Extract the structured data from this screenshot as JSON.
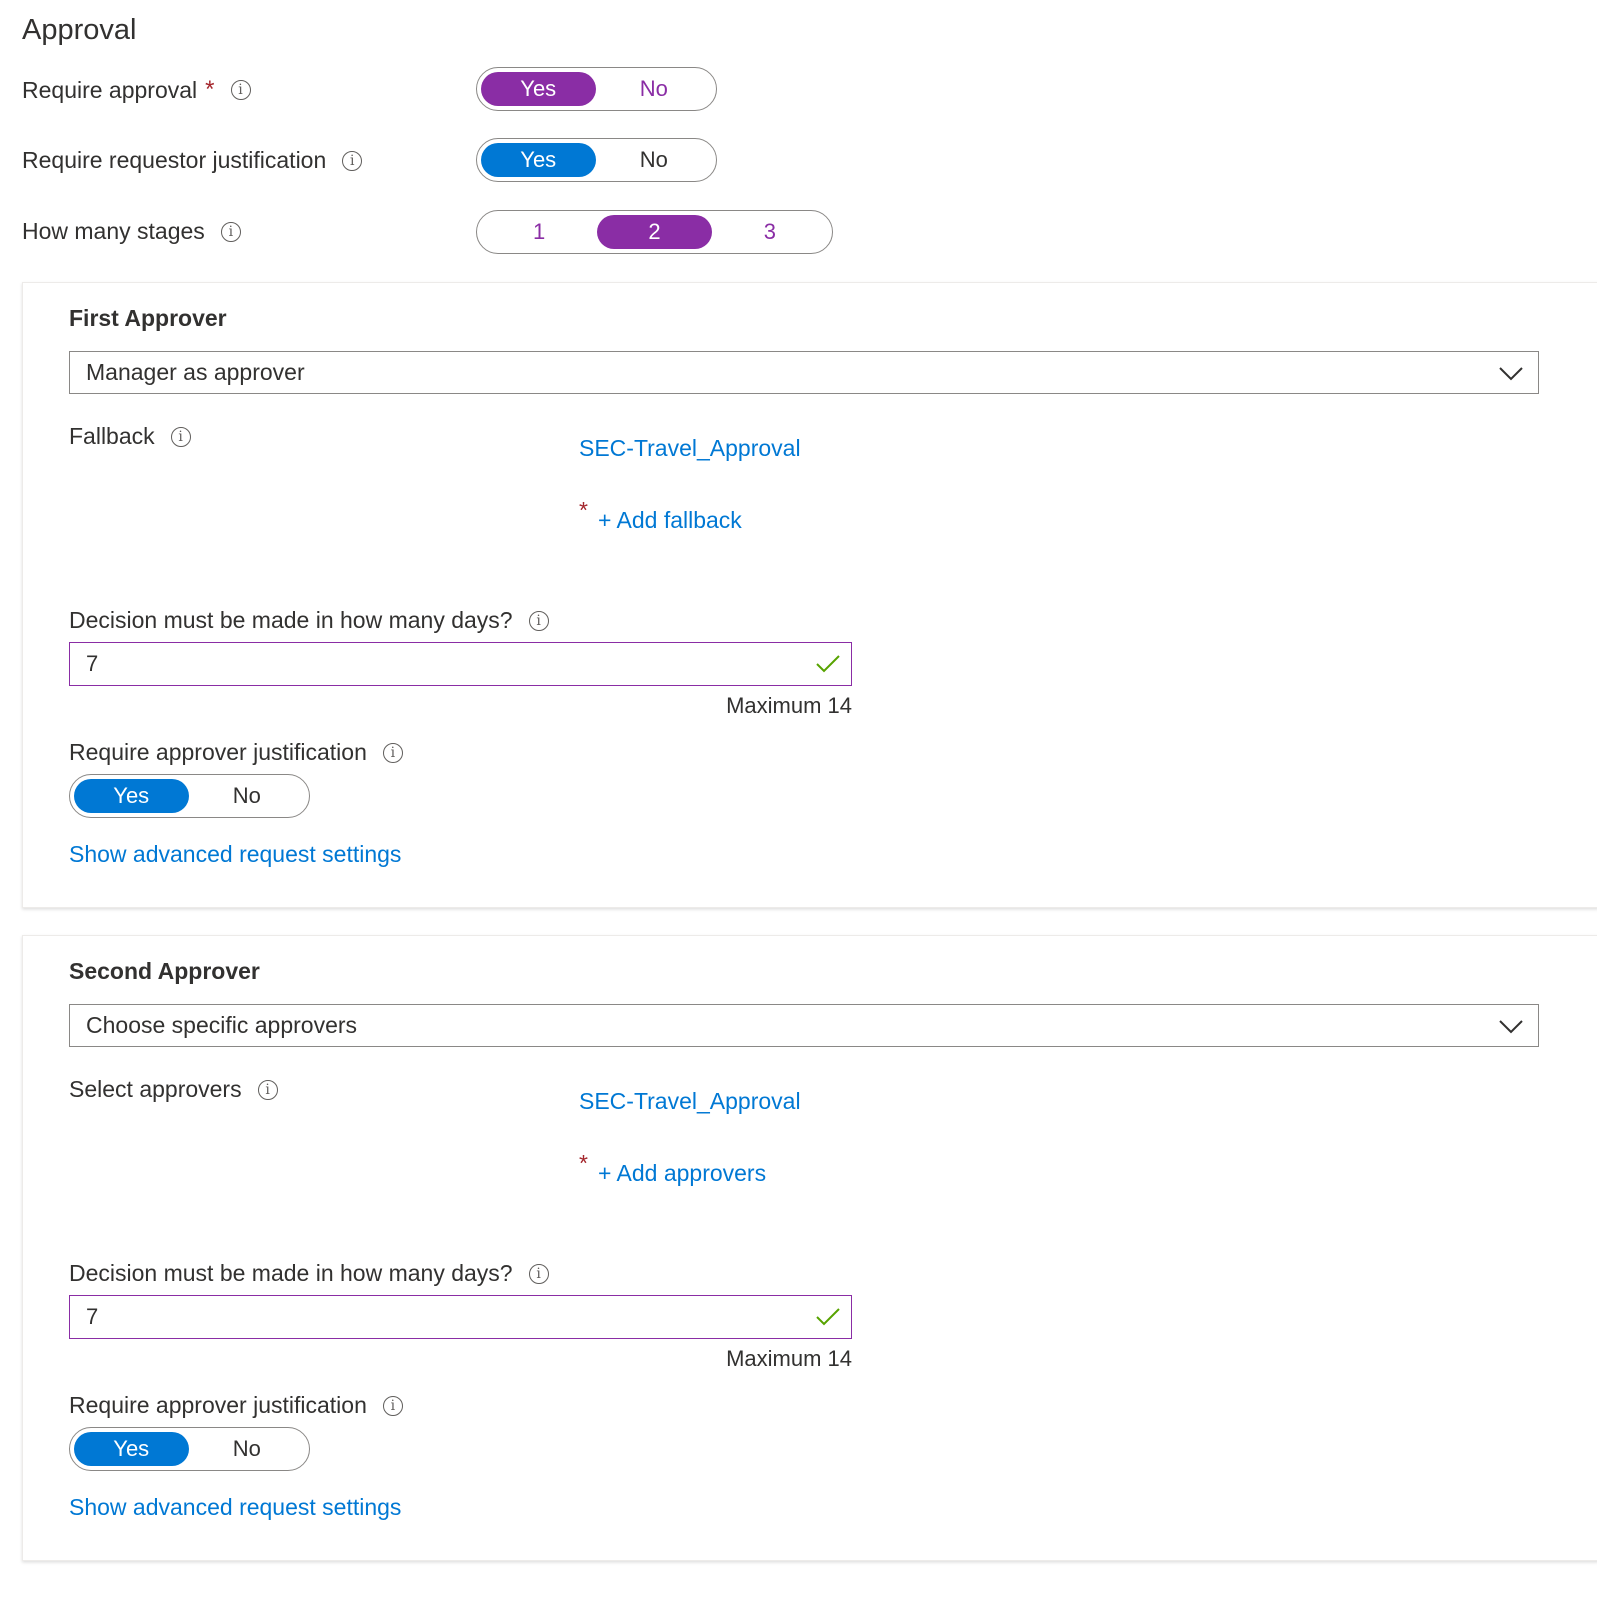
{
  "section_title": "Approval",
  "require_approval": {
    "label": "Require approval",
    "required_mark": "*",
    "options": [
      "Yes",
      "No"
    ],
    "selected": "Yes"
  },
  "require_justification": {
    "label": "Require requestor justification",
    "options": [
      "Yes",
      "No"
    ],
    "selected": "Yes"
  },
  "stages": {
    "label": "How many stages",
    "options": [
      "1",
      "2",
      "3"
    ],
    "selected": "2"
  },
  "info_glyph": "i",
  "first_approver": {
    "title": "First Approver",
    "dropdown_value": "Manager as approver",
    "fallback_label": "Fallback",
    "fallback_group": "SEC-Travel_Approval",
    "required_mark": "*",
    "add_link": "+ Add fallback",
    "decision_label": "Decision must be made in how many days?",
    "decision_value": "7",
    "decision_hint": "Maximum 14",
    "approver_just_label": "Require approver justification",
    "approver_just_options": [
      "Yes",
      "No"
    ],
    "approver_just_selected": "Yes",
    "advanced_link": "Show advanced request settings"
  },
  "second_approver": {
    "title": "Second Approver",
    "dropdown_value": "Choose specific approvers",
    "select_label": "Select approvers",
    "approver_group": "SEC-Travel_Approval",
    "required_mark": "*",
    "add_link": "+ Add approvers",
    "decision_label": "Decision must be made in how many days?",
    "decision_value": "7",
    "decision_hint": "Maximum 14",
    "approver_just_label": "Require approver justification",
    "approver_just_options": [
      "Yes",
      "No"
    ],
    "approver_just_selected": "Yes",
    "advanced_link": "Show advanced request settings"
  },
  "colors": {
    "purple": "#8a2da5",
    "blue": "#0078d4",
    "required": "#a4262c",
    "valid": "#57a300"
  },
  "icons": [
    "info-icon",
    "chevron-down-icon",
    "checkmark-icon"
  ]
}
